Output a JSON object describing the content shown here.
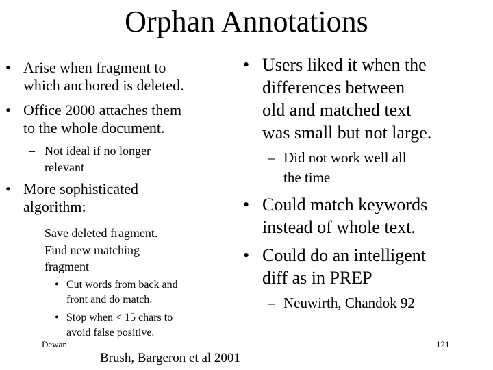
{
  "slide": {
    "title": "Orphan Annotations",
    "left_column": {
      "bullets": [
        {
          "lines": [
            "Arise when fragment to",
            "which anchored is deleted."
          ]
        },
        {
          "lines": [
            "Office 2000 attaches them",
            "to the whole document."
          ],
          "sub": [
            {
              "lines": [
                "Not ideal if no longer",
                "relevant"
              ]
            }
          ]
        },
        {
          "lines": [
            "More sophisticated",
            "algorithm:"
          ],
          "sub": [
            {
              "lines": [
                "Save deleted fragment."
              ]
            },
            {
              "lines": [
                "Find new matching",
                "fragment"
              ],
              "sub": [
                {
                  "lines": [
                    "Cut words from back and",
                    "front and do match."
                  ]
                },
                {
                  "lines": [
                    "Stop when < 15 chars to",
                    "avoid false positive."
                  ]
                }
              ]
            }
          ]
        }
      ]
    },
    "right_column": {
      "bullets": [
        {
          "lines": [
            "Users liked it when the",
            "differences between",
            "old and matched text",
            "was small but not large."
          ],
          "sub": [
            {
              "lines": [
                "Did not work well all",
                "the time"
              ]
            }
          ]
        },
        {
          "lines": [
            "Could match keywords",
            "instead of whole text."
          ]
        },
        {
          "lines": [
            "Could do an intelligent",
            "diff as in PREP"
          ],
          "sub": [
            {
              "lines": [
                "Neuwirth, Chandok 92"
              ]
            }
          ]
        }
      ]
    },
    "bullet_glyphs": {
      "level1": "•",
      "level2": "–",
      "level3": "•"
    },
    "footer": {
      "author": "Dewan",
      "page_number": "121",
      "citation": "Brush, Bargeron et al 2001"
    }
  }
}
